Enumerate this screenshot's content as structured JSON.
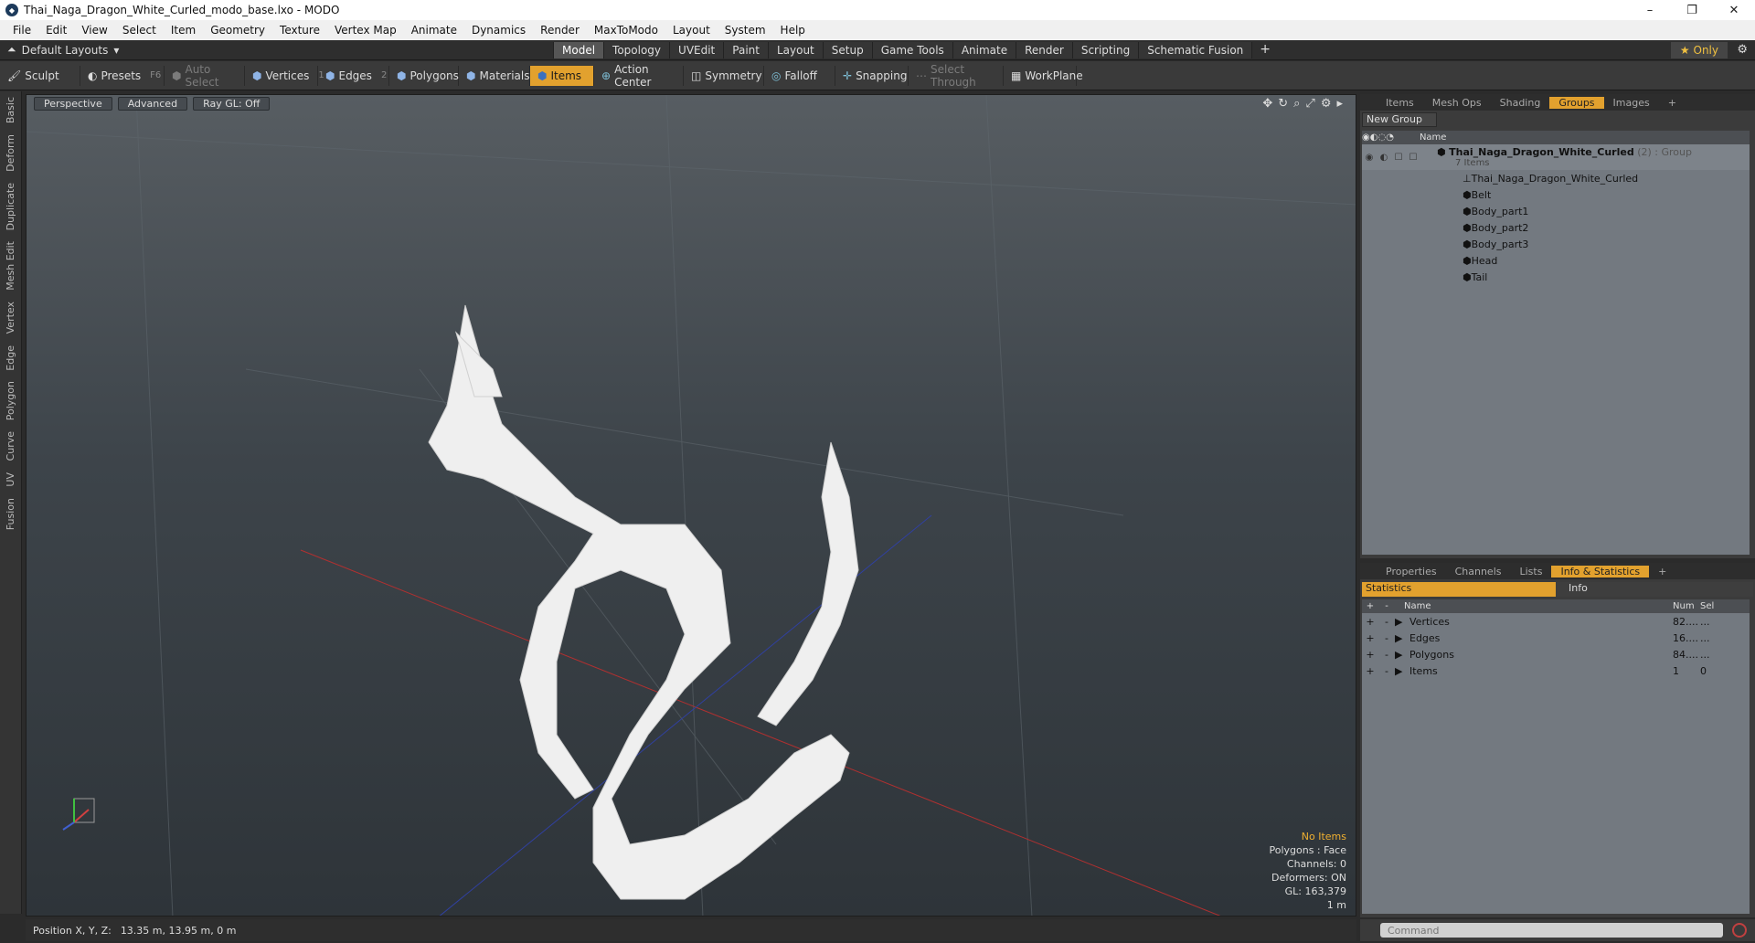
{
  "window": {
    "title": "Thai_Naga_Dragon_White_Curled_modo_base.lxo - MODO",
    "minimize": "–",
    "maximize": "❐",
    "close": "✕"
  },
  "menu": [
    "File",
    "Edit",
    "View",
    "Select",
    "Item",
    "Geometry",
    "Texture",
    "Vertex Map",
    "Animate",
    "Dynamics",
    "Render",
    "MaxToModo",
    "Layout",
    "System",
    "Help"
  ],
  "layout_selector": "Default Layouts",
  "main_tabs": [
    "Model",
    "Topology",
    "UVEdit",
    "Paint",
    "Layout",
    "Setup",
    "Game Tools",
    "Animate",
    "Render",
    "Scripting",
    "Schematic Fusion"
  ],
  "active_main_tab": "Model",
  "only_label": "Only",
  "toolbar": {
    "sculpt": "Sculpt",
    "presets": "Presets",
    "presets_key": "F6",
    "auto_select": "Auto Select",
    "vertices": "Vertices",
    "vertices_key": "1",
    "edges": "Edges",
    "edges_key": "2",
    "polygons": "Polygons",
    "materials": "Materials",
    "items": "Items",
    "action_center": "Action Center",
    "symmetry": "Symmetry",
    "falloff": "Falloff",
    "snapping": "Snapping",
    "select_through": "Select Through",
    "workplane": "WorkPlane"
  },
  "left_tabs": [
    "Basic",
    "Deform",
    "Duplicate",
    "Mesh Edit",
    "Vertex",
    "Edge",
    "Polygon",
    "Curve",
    "UV",
    "Fusion"
  ],
  "viewport": {
    "view": "Perspective",
    "shading": "Advanced",
    "raygl": "Ray GL: Off",
    "info": {
      "no_items": "No Items",
      "polygons": "Polygons : Face",
      "channels": "Channels: 0",
      "deformers": "Deformers: ON",
      "gl": "GL: 163,379",
      "scale": "1 m"
    }
  },
  "status": {
    "label": "Position X, Y, Z:",
    "value": "13.35 m, 13.95 m, 0 m"
  },
  "top_panel": {
    "tabs": [
      "Items",
      "Mesh Ops",
      "Shading",
      "Groups",
      "Images"
    ],
    "active": "Groups",
    "new_group": "New Group",
    "name_header": "Name",
    "group": {
      "name": "Thai_Naga_Dragon_White_Curled",
      "count": "(2)",
      "type": ": Group",
      "sub": "7 Items"
    },
    "children": [
      "Thai_Naga_Dragon_White_Curled",
      "Belt",
      "Body_part1",
      "Body_part2",
      "Body_part3",
      "Head",
      "Tail"
    ]
  },
  "bottom_panel": {
    "tabs": [
      "Properties",
      "Channels",
      "Lists",
      "Info & Statistics"
    ],
    "active": "Info & Statistics",
    "subtabs": [
      "Statistics",
      "Info"
    ],
    "headers": {
      "name": "Name",
      "num": "Num",
      "sel": "Sel"
    },
    "rows": [
      {
        "name": "Vertices",
        "num": "82....",
        "sel": "..."
      },
      {
        "name": "Edges",
        "num": "16....",
        "sel": "..."
      },
      {
        "name": "Polygons",
        "num": "84....",
        "sel": "..."
      },
      {
        "name": "Items",
        "num": "1",
        "sel": "0"
      }
    ]
  },
  "command": {
    "placeholder": "Command"
  }
}
